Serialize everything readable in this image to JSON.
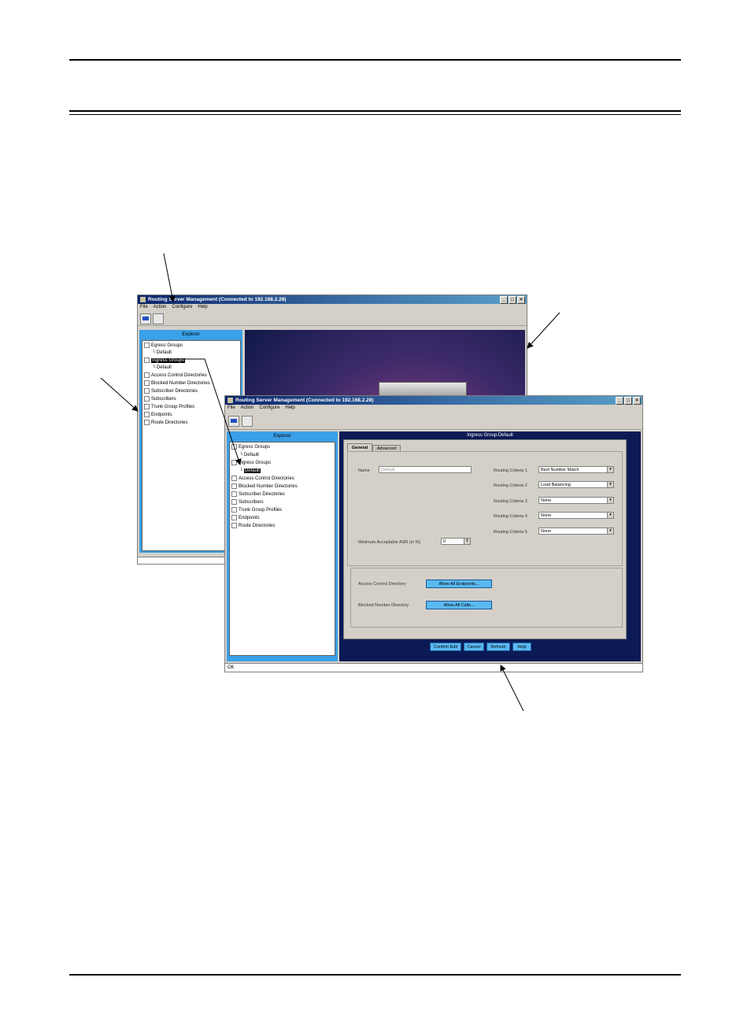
{
  "back_window": {
    "title": "Routing Server Management (Connected to 192.168.2.28)",
    "menu": [
      "File",
      "Action",
      "Configure",
      "Help"
    ],
    "window_buttons": [
      "_",
      "□",
      "×"
    ],
    "explorer_title": "Explorer",
    "tree": [
      {
        "label": "Egress Groups"
      },
      {
        "label": "Default"
      },
      {
        "label": "Ingress Groups"
      },
      {
        "label": "Default"
      },
      {
        "label": "Access Control Directories"
      },
      {
        "label": "Blocked Number Directories"
      },
      {
        "label": "Subscriber Directories"
      },
      {
        "label": "Subscribers"
      },
      {
        "label": "Trunk Group Profiles"
      },
      {
        "label": "Endpoints"
      },
      {
        "label": "Route Directories"
      }
    ]
  },
  "front_window": {
    "title": "Routing Server Management (Connected to 192.168.2.28)",
    "menu": [
      "File",
      "Action",
      "Configure",
      "Help"
    ],
    "window_buttons": [
      "_",
      "□",
      "×"
    ],
    "explorer_title": "Explorer",
    "tree": [
      {
        "label": "Egress Groups"
      },
      {
        "label": "Default"
      },
      {
        "label": "Ingress Groups"
      },
      {
        "label": "Default"
      },
      {
        "label": "Access Control Directories"
      },
      {
        "label": "Blocked Number Directories"
      },
      {
        "label": "Subscriber Directories"
      },
      {
        "label": "Subscribers"
      },
      {
        "label": "Trunk Group Profiles"
      },
      {
        "label": "Endpoints"
      },
      {
        "label": "Route Directories"
      }
    ],
    "panel_title": "Ingress Group:Default",
    "tabs": [
      "General",
      "Advanced"
    ],
    "name_label": "Name",
    "name_value": "Default",
    "routing": [
      {
        "label": "Routing Criteria 1",
        "value": "Best Number Match"
      },
      {
        "label": "Routing Criteria 2",
        "value": "Load Balancing"
      },
      {
        "label": "Routing Criteria 3",
        "value": "None"
      },
      {
        "label": "Routing Criteria 4",
        "value": "None"
      },
      {
        "label": "Routing Criteria 5",
        "value": "None"
      }
    ],
    "asr_label": "Minimum Acceptable ASR (in %)",
    "asr_value": "0",
    "acd_label": "Access Control Directory",
    "acd_button": "Allow All Endpoints...",
    "bnd_label": "Blocked Number Directory",
    "bnd_button": "Allow All Calls...",
    "actions": [
      "Confirm Edit",
      "Cancel",
      "Refresh",
      "Help"
    ],
    "status": "OK"
  },
  "colors": {
    "titlebar": "#0a246a",
    "explorer": "#3aa0e8",
    "content_bg": "#0b1a55",
    "button": "#5ab8f0"
  }
}
